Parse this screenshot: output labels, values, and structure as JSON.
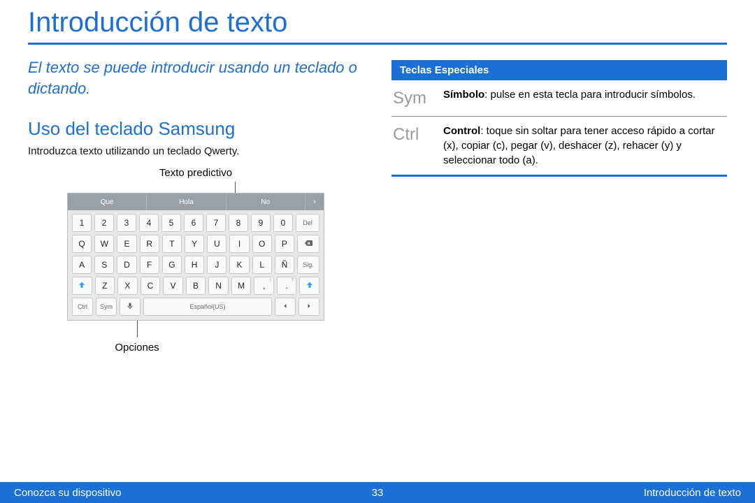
{
  "title": "Introducción de texto",
  "intro": "El texto se puede introducir usando un teclado o dictando.",
  "section_heading": "Uso del teclado Samsung",
  "section_body": "Introduzca texto utilizando un teclado Qwerty.",
  "callout_top": "Texto predictivo",
  "callout_bottom": "Opciones",
  "keyboard": {
    "suggestions": [
      "Que",
      "Hola",
      "No"
    ],
    "more_glyph": "›",
    "row_numbers": [
      "1",
      "2",
      "3",
      "4",
      "5",
      "6",
      "7",
      "8",
      "9",
      "0"
    ],
    "num_del_label": "Del",
    "row_qwerty": [
      "Q",
      "W",
      "E",
      "R",
      "T",
      "Y",
      "U",
      "I",
      "O",
      "P"
    ],
    "row_asdf": [
      "A",
      "S",
      "D",
      "F",
      "G",
      "H",
      "J",
      "K",
      "L",
      "Ñ"
    ],
    "sig_label": "Sig.",
    "row_zxcv": [
      "Z",
      "X",
      "C",
      "V",
      "B",
      "N",
      "M"
    ],
    "comma_key": ",",
    "comma_sup": "!",
    "dot_key": ".",
    "dot_sup": "?",
    "ctrl_label": "Ctrl",
    "sym_label": "Sym",
    "space_label": "Español(US)"
  },
  "special_keys_header": "Teclas Especiales",
  "special_keys": [
    {
      "key": "Sym",
      "name_bold": "Símbolo",
      "desc_rest": ": pulse en esta tecla para introducir símbolos."
    },
    {
      "key": "Ctrl",
      "name_bold": "Control",
      "desc_rest": ": toque sin soltar para tener acceso rápido a cortar (x), copiar (c), pegar (v), deshacer (z), rehacer (y) y seleccionar todo (a)."
    }
  ],
  "footer": {
    "left": "Conozca su dispositivo",
    "page": "33",
    "right": "Introducción de texto"
  }
}
